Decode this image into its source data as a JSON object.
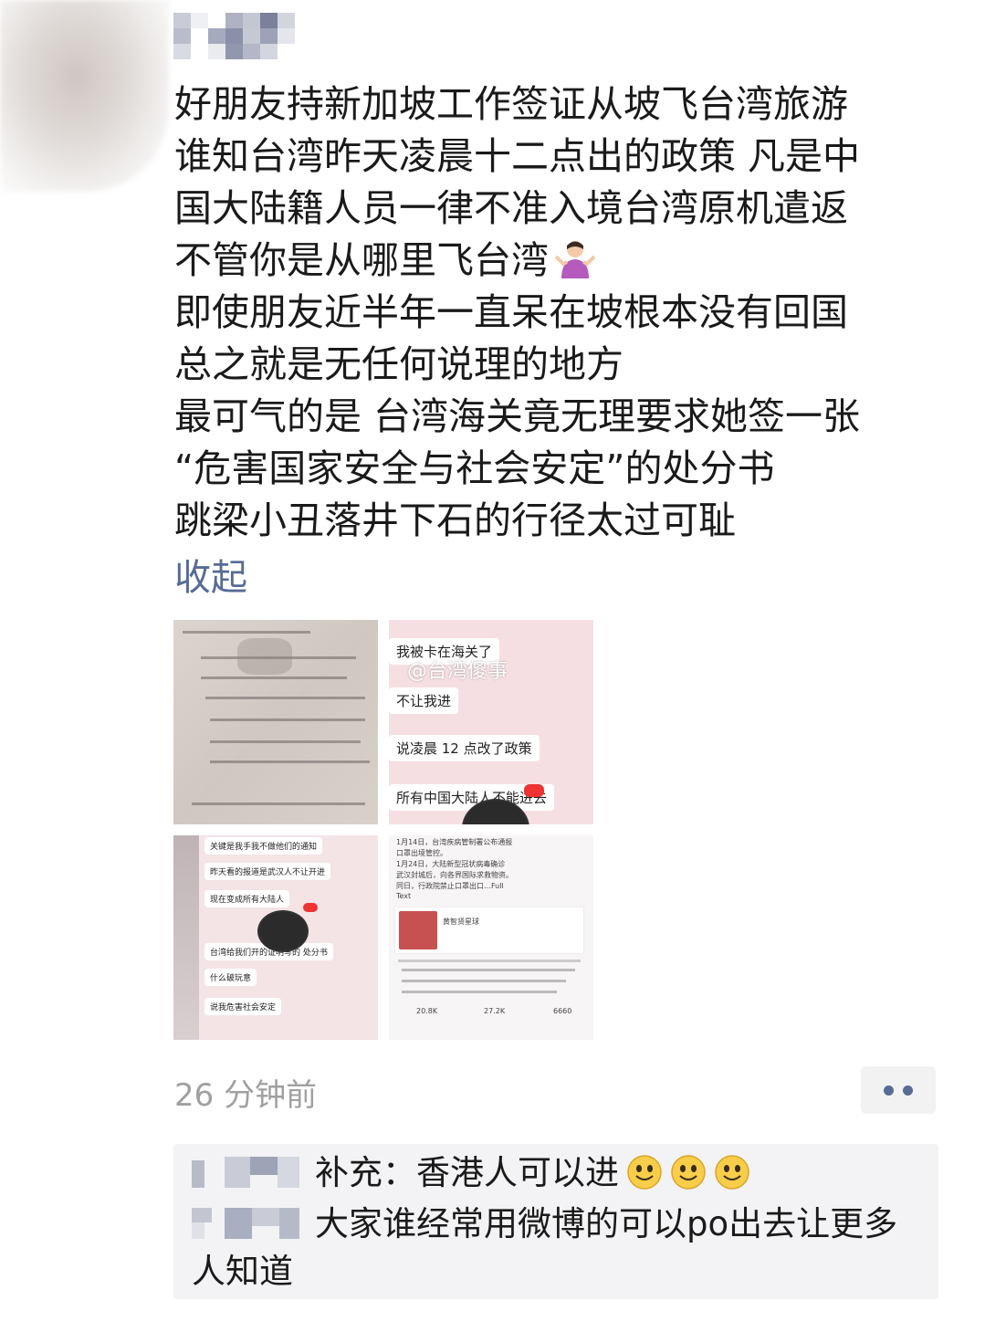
{
  "post": {
    "lines": [
      "好朋友持新加坡工作签证从坡飞台湾旅游",
      "谁知台湾昨天凌晨十二点出的政策 凡是中",
      "国大陆籍人员一律不准入境台湾原机遣返",
      "不管你是从哪里飞台湾",
      "即使朋友近半年一直呆在坡根本没有回国",
      "总之就是无任何说理的地方",
      "最可气的是 台湾海关竟无理要求她签一张",
      "“危害国家安全与社会安定”的处分书",
      "跳梁小丑落井下石的行径太过可耻"
    ],
    "collapse_label": "收起",
    "timestamp": "26 分钟前",
    "emoji_icon": "shrug-emoji-icon"
  },
  "images": {
    "thumb2": {
      "watermark": "@台湾傻事",
      "messages": [
        "我被卡在海关了",
        "不让我进",
        "说凌晨 12 点改了政策",
        "所有中国大陆人不能进去"
      ]
    },
    "thumb3": {
      "messages": [
        "关键是我手我不做他们的通知",
        "昨天看的报道是武汉人不让开进",
        "现在变成所有大陆人",
        "台湾给我们开的证明写的 处分书",
        "什么破玩意",
        "说我危害社会安定"
      ]
    },
    "thumb4": {
      "lines": [
        "1月14日，台湾疾病管制署公布通报",
        "口罩出境管控。",
        "1月24日，大陆新型冠状病毒确诊",
        "武汉封城后，向各界国际求救物资。",
        "同日，行政院禁止口罩出口…Full",
        "Text"
      ],
      "card_title": "黄智贤星球",
      "stats": [
        "20.8K",
        "27.2K",
        "6660"
      ]
    }
  },
  "comments": [
    {
      "text": "补充：香港人可以进",
      "emoji_icons": [
        "smile-emoji-icon",
        "smile-emoji-icon",
        "smile-emoji-icon"
      ]
    },
    {
      "text": "大家谁经常用微博的可以po出去让更多人知道"
    }
  ],
  "colors": {
    "link": "#576b95",
    "timestamp": "#a0a0a0",
    "comment_bg": "#f3f3f5"
  }
}
